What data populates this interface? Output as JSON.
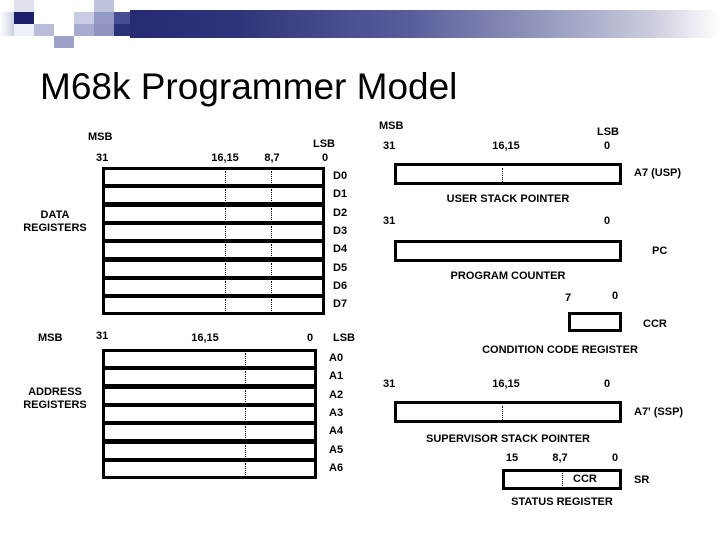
{
  "slide": {
    "title": "M68k Programmer Model",
    "background_color": "#ffffff",
    "accent_color": "#262b72"
  },
  "decoration": {
    "name": "corner-squares-and-gradient-bar",
    "bar_gradient_from": "#262b72",
    "bar_gradient_to": "#ffffff"
  },
  "data_registers": {
    "section_label_line1": "DATA",
    "section_label_line2": "REGISTERS",
    "msb_label": "MSB",
    "lsb_label": "LSB",
    "bit_31": "31",
    "bit_16_15": "16,15",
    "bit_8_7": "8,7",
    "bit_0": "0",
    "registers": [
      "D0",
      "D1",
      "D2",
      "D3",
      "D4",
      "D5",
      "D6",
      "D7"
    ]
  },
  "address_registers": {
    "section_label_line1": "ADDRESS",
    "section_label_line2": "REGISTERS",
    "msb_label": "MSB",
    "lsb_label": "LSB",
    "bit_31": "31",
    "bit_16_15": "16,15",
    "bit_0": "0",
    "registers": [
      "A0",
      "A1",
      "A2",
      "A3",
      "A4",
      "A5",
      "A6"
    ]
  },
  "user_stack_pointer": {
    "msb_label": "MSB",
    "lsb_label": "LSB",
    "bit_31": "31",
    "bit_16_15": "16,15",
    "bit_0": "0",
    "register_name": "A7 (USP)",
    "caption": "USER STACK POINTER"
  },
  "program_counter": {
    "bit_31": "31",
    "bit_0": "0",
    "register_name": "PC",
    "caption": "PROGRAM COUNTER"
  },
  "condition_code_register": {
    "bit_7": "7",
    "bit_0": "0",
    "register_name": "CCR",
    "caption": "CONDITION CODE REGISTER"
  },
  "supervisor_stack_pointer": {
    "bit_31": "31",
    "bit_16_15": "16,15",
    "bit_0": "0",
    "register_name": "A7' (SSP)",
    "caption": "SUPERVISOR STACK POINTER"
  },
  "status_register": {
    "bit_15": "15",
    "bit_8_7": "8,7",
    "bit_0": "0",
    "register_name": "SR",
    "inner_field_label": "CCR",
    "caption": "STATUS REGISTER"
  }
}
